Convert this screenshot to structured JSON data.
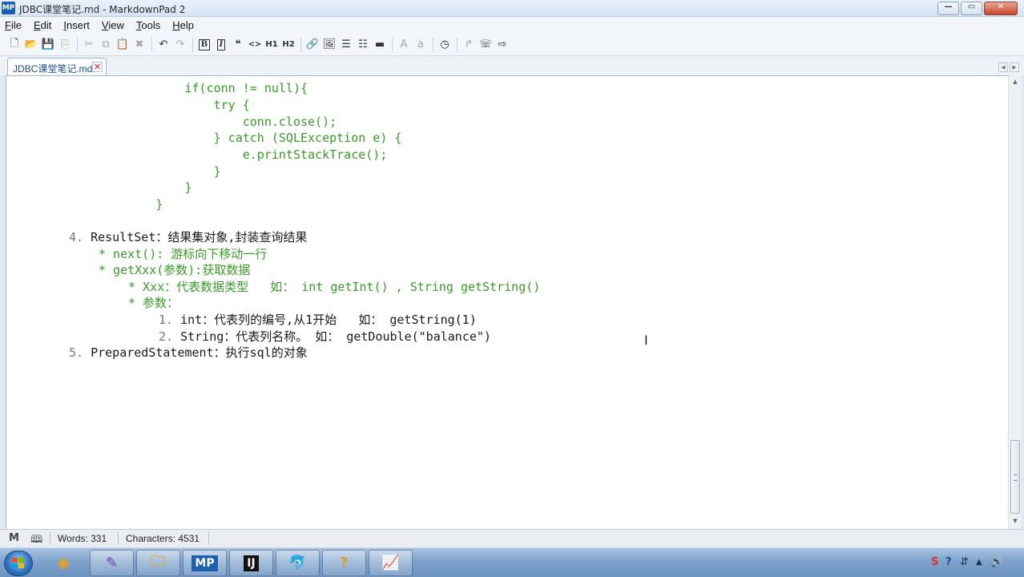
{
  "window": {
    "title": "JDBC课堂笔记.md - MarkdownPad 2",
    "app_icon": "MP",
    "minimize_glyph": "—",
    "maximize_glyph": "▭",
    "close_glyph": "✕"
  },
  "menu": [
    {
      "key": "F",
      "rest": "ile"
    },
    {
      "key": "E",
      "rest": "dit"
    },
    {
      "key": "I",
      "rest": "nsert"
    },
    {
      "key": "V",
      "rest": "iew"
    },
    {
      "key": "T",
      "rest": "ools"
    },
    {
      "key": "H",
      "rest": "elp"
    }
  ],
  "toolbar": {
    "new": "🗋",
    "open": "📂",
    "save": "💾",
    "save_all": "⎘",
    "cut": "✂",
    "copy": "⧉",
    "paste": "📋",
    "delete": "✖",
    "undo": "↶",
    "redo": "↷",
    "bold": "B",
    "italic": "I",
    "quote": "❝",
    "code": "<>",
    "h1": "H1",
    "h2": "H2",
    "link": "🔗",
    "image": "🖼",
    "ul": "☰",
    "ol": "☷",
    "hr": "▬",
    "upper": "A",
    "lower": "a",
    "timestamp": "◷",
    "a1": "↱",
    "a2": "☏",
    "a3": "⇨"
  },
  "tab": {
    "label": "JDBC课堂笔记.md",
    "close": "✕",
    "left_arrow": "◀",
    "right_arrow": "▶"
  },
  "editor": {
    "lines": [
      {
        "indent": "                ",
        "text": "if(conn != null){",
        "style": "code"
      },
      {
        "indent": "                    ",
        "text": "try {",
        "style": "code"
      },
      {
        "indent": "                        ",
        "text": "conn.close();",
        "style": "code"
      },
      {
        "indent": "                    ",
        "text": "} catch (SQLException e) {",
        "style": "code"
      },
      {
        "indent": "                        ",
        "text": "e.printStackTrace();",
        "style": "code"
      },
      {
        "indent": "                    ",
        "text": "}",
        "style": "code"
      },
      {
        "indent": "                ",
        "text": "}",
        "style": "code"
      },
      {
        "indent": "            ",
        "text": "}",
        "style": "code"
      }
    ],
    "item4": {
      "num": "4.",
      "text": "ResultSet：结果集对象,封装查询结果"
    },
    "item4_sub1": "* next(): 游标向下移动一行",
    "item4_sub2": "* getXxx(参数):获取数据",
    "item4_sub2_a": "* Xxx：代表数据类型   如： int getInt() , String getString()",
    "item4_sub2_b": "* 参数：",
    "param1": {
      "num": "1.",
      "text": "int：代表列的编号,从1开始   如： getString(1)"
    },
    "param2": {
      "num": "2.",
      "text": "String：代表列名称。 如： getDouble(\"balance\")"
    },
    "item5": {
      "num": "5.",
      "text": "PreparedStatement：执行sql的对象"
    },
    "cursor": "I"
  },
  "scrollbar": {
    "up": "▲",
    "down": "▼"
  },
  "status": {
    "markdown_icon": "M",
    "preview_icon": "🕮",
    "words_label": "Words: 331",
    "characters_label": "Characters: 4531"
  },
  "taskbar": {
    "apps": [
      {
        "name": "chrome",
        "glyph": "◉",
        "color": "#e8a020"
      },
      {
        "name": "editor",
        "glyph": "✎",
        "color": "#6a3fa8"
      },
      {
        "name": "explorer",
        "glyph": "🗀",
        "color": "#d8b040"
      },
      {
        "name": "markdownpad",
        "glyph": "MP",
        "color": "#1b5fae"
      },
      {
        "name": "intellij",
        "glyph": "IJ",
        "color": "#111111"
      },
      {
        "name": "mysql",
        "glyph": "🐬",
        "color": "#3b6ea8"
      },
      {
        "name": "help",
        "glyph": "?",
        "color": "#d8a020"
      },
      {
        "name": "notepad",
        "glyph": "📈",
        "color": "#4a8a2a"
      }
    ],
    "tray": {
      "ime": "S",
      "help": "?",
      "network": "⇵",
      "flag": "▲",
      "volume": "🔊"
    }
  }
}
